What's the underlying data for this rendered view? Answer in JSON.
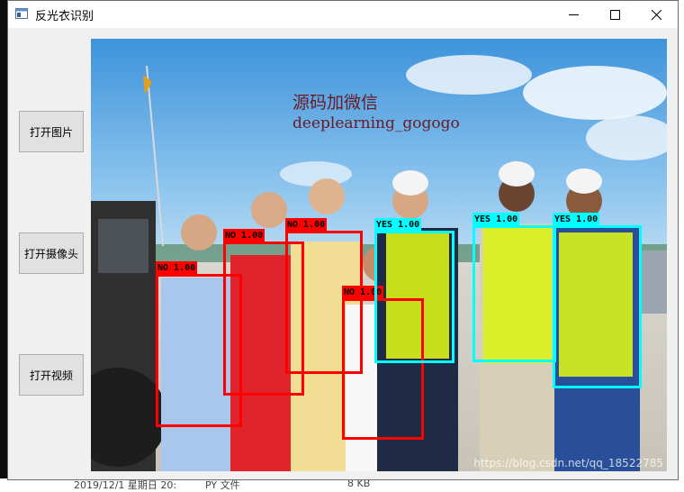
{
  "window": {
    "title": "反光衣识别"
  },
  "buttons": {
    "open_image": "打开图片",
    "open_camera": "打开摄像头",
    "open_video": "打开视频"
  },
  "watermark": {
    "line1": "源码加微信",
    "line2": "deeplearning_gogogo"
  },
  "detections": [
    {
      "label": "NO 1.00",
      "color": "#ff0000"
    },
    {
      "label": "NO 1.00",
      "color": "#ff0000"
    },
    {
      "label": "NO 1.00",
      "color": "#ff0000"
    },
    {
      "label": "NO 1.00",
      "color": "#ff0000"
    },
    {
      "label": "YES 1.00",
      "color": "#00ffff"
    },
    {
      "label": "YES 1.00",
      "color": "#00ffff"
    },
    {
      "label": "YES 1.00",
      "color": "#00ffff"
    }
  ],
  "image_watermark": "https://blog.csdn.net/qq_18522785",
  "background_row": {
    "date": "2019/12/1 星期日 20:",
    "type": "PY 文件",
    "size": "8 KB"
  },
  "colors": {
    "no_vest": "#ff0000",
    "has_vest": "#00ffff"
  }
}
